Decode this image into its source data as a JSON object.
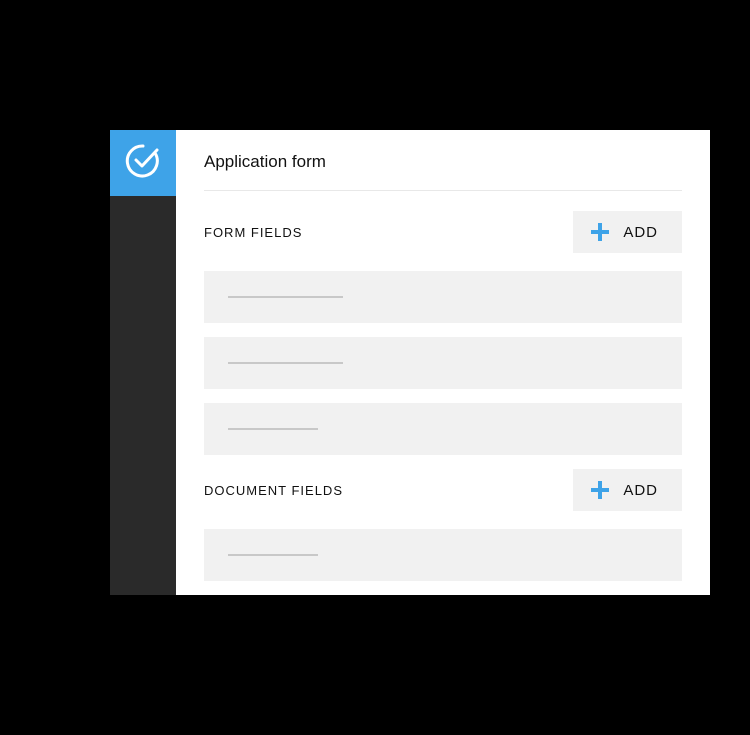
{
  "page": {
    "title": "Application form"
  },
  "sections": {
    "form_fields": {
      "label": "FORM FIELDS",
      "add_label": "ADD",
      "rows": [
        {
          "width": "long"
        },
        {
          "width": "long"
        },
        {
          "width": "short"
        }
      ]
    },
    "document_fields": {
      "label": "DOCUMENT FIELDS",
      "add_label": "ADD",
      "rows": [
        {
          "width": "short"
        }
      ]
    }
  },
  "colors": {
    "accent": "#3ea3e8",
    "sidebar": "#2a2a2a",
    "panel": "#f1f1f1"
  },
  "icons": {
    "logo": "checkmark-circle",
    "add": "plus"
  }
}
